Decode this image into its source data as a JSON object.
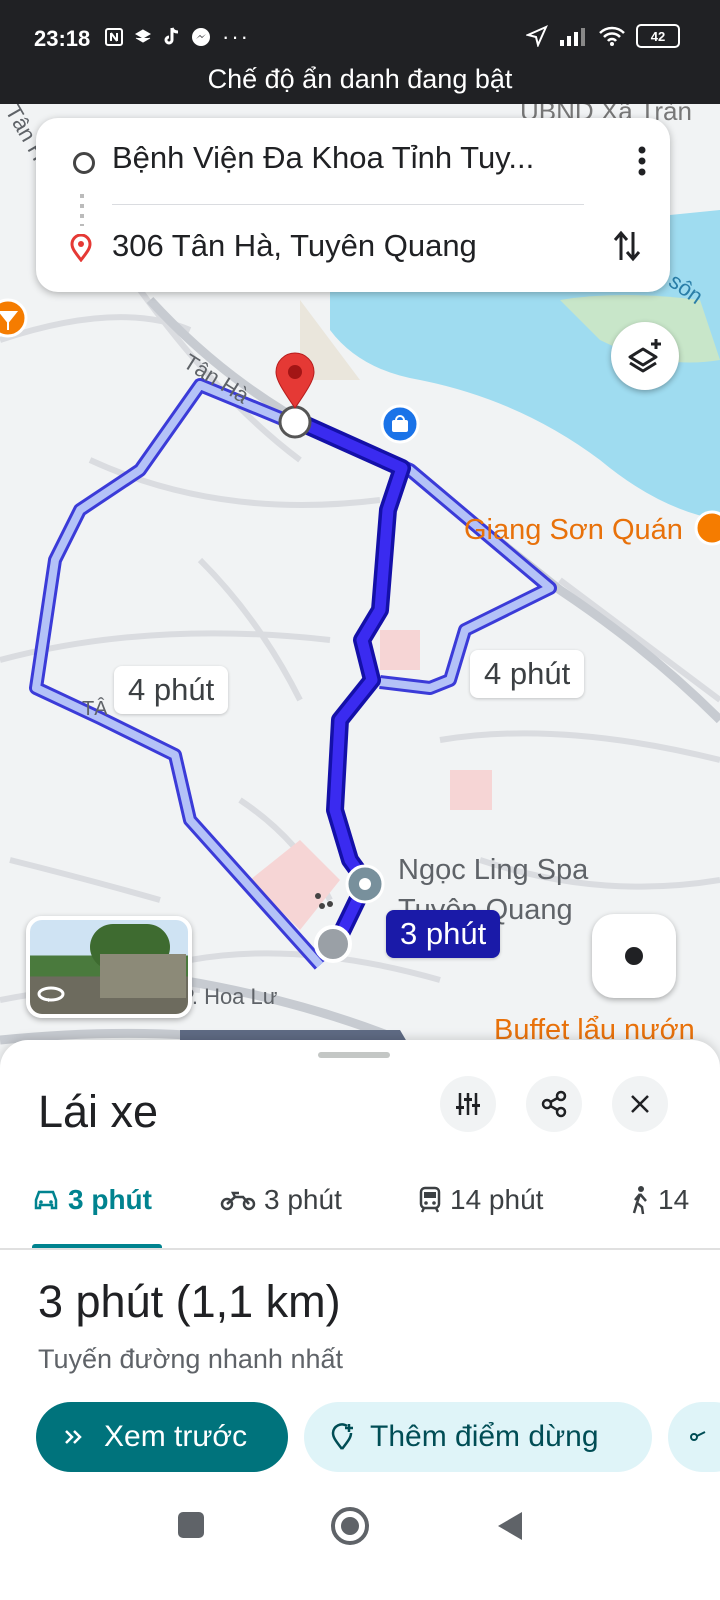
{
  "status_bar": {
    "time": "23:18",
    "battery": "42",
    "incognito_text": "Chế độ ẩn danh đang bật"
  },
  "search": {
    "origin": "Bệnh Viện Đa Khoa Tỉnh Tuy...",
    "destination": "306 Tân Hà, Tuyên Quang"
  },
  "map": {
    "labels": {
      "street_tan_ha": "Tân Hà",
      "street_tan_ha_corner": "Tân H",
      "ubnd": "UBND Xã Tràn",
      "place_giang_son": "Giang Sơn Quán",
      "place_ngoc_ling": "Ngọc Ling Spa",
      "place_ngoc_ling_2": "Tuyên Quang",
      "place_buffet": "Buffet lẩu nướn",
      "street_hoa_lu": "P. Hoa Lư",
      "area_ta": "TÂ",
      "river_song": "sôn"
    },
    "eta_left": "4 phút",
    "eta_right": "4 phút",
    "eta_primary": "3 phút"
  },
  "sheet": {
    "title": "Lái xe",
    "tabs": [
      {
        "icon": "car-icon",
        "label": "3 phút"
      },
      {
        "icon": "motorbike-icon",
        "label": "3 phút"
      },
      {
        "icon": "transit-icon",
        "label": "14 phút"
      },
      {
        "icon": "walk-icon",
        "label": "14"
      }
    ],
    "duration": "3 phút",
    "distance": "(1,1 km)",
    "route_note": "Tuyến đường nhanh nhất",
    "preview_label": "Xem trước",
    "add_stop_label": "Thêm điểm dừng"
  },
  "colors": {
    "primary_route": "#2a1fd9",
    "alt_route": "#a9b8f5",
    "accent": "#00838f",
    "destination_pin": "#e53935"
  }
}
